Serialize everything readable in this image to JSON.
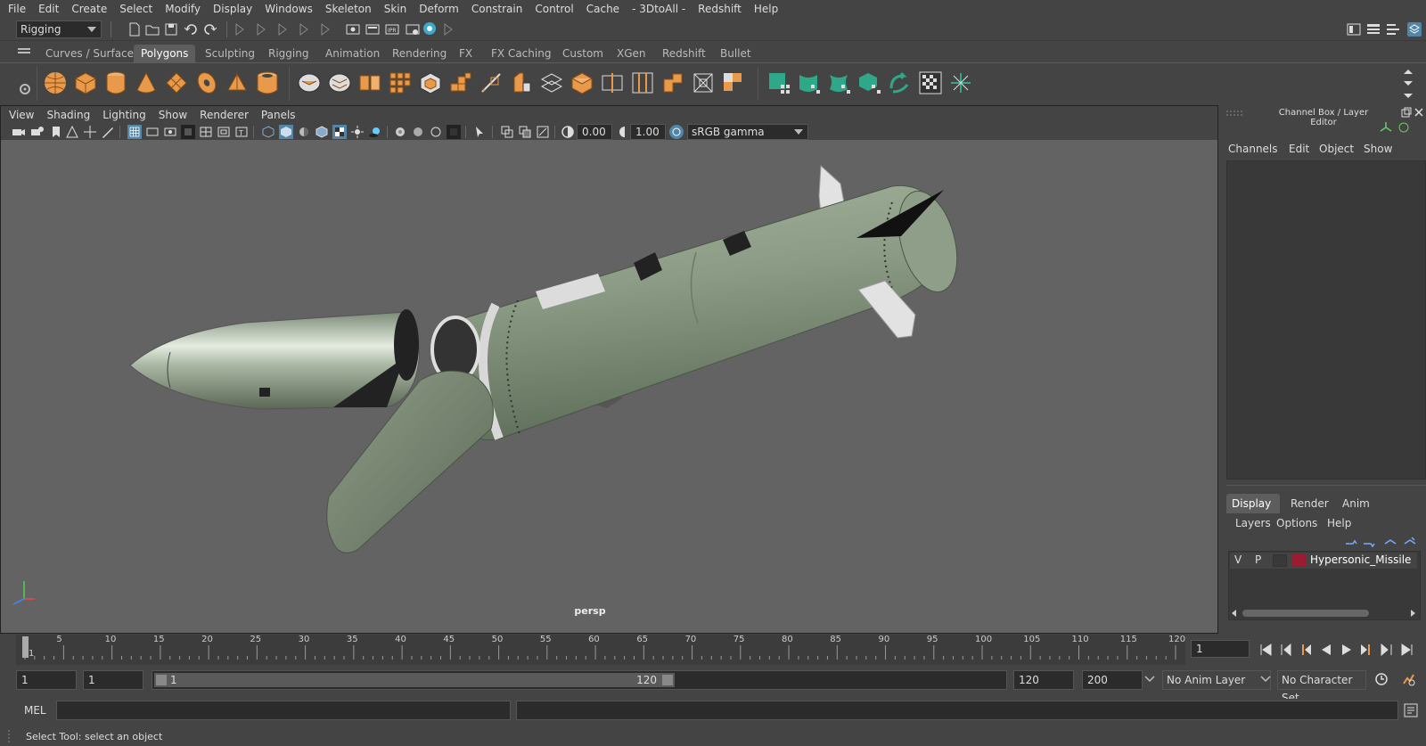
{
  "menubar": {
    "items": [
      "File",
      "Edit",
      "Create",
      "Select",
      "Modify",
      "Display",
      "Windows",
      "Skeleton",
      "Skin",
      "Deform",
      "Constrain",
      "Control",
      "Cache",
      "- 3DtoAll -",
      "Redshift",
      "Help"
    ]
  },
  "statusline": {
    "menuset": "Rigging"
  },
  "shelf": {
    "tabs": [
      "Curves / Surfaces",
      "Polygons",
      "Sculpting",
      "Rigging",
      "Animation",
      "Rendering",
      "FX",
      "FX Caching",
      "Custom",
      "XGen",
      "Redshift",
      "Bullet"
    ],
    "active_tab": "Polygons"
  },
  "viewport": {
    "menu": [
      "View",
      "Shading",
      "Lighting",
      "Show",
      "Renderer",
      "Panels"
    ],
    "exposure": "0.00",
    "gamma": "1.00",
    "color_space": "sRGB gamma",
    "camera_label": "persp"
  },
  "rightpanel": {
    "title": "Channel Box / Layer Editor",
    "channel_menu": [
      "Channels",
      "Edit",
      "Object",
      "Show"
    ],
    "layer_tabs": [
      "Display",
      "Render",
      "Anim"
    ],
    "active_layer_tab": "Display",
    "layer_menu": [
      "Layers",
      "Options",
      "Help"
    ],
    "layer": {
      "v": "V",
      "p": "P",
      "name": "Hypersonic_Missile",
      "color": "#9b1b30"
    }
  },
  "timeline": {
    "ticks": [
      "1",
      "5",
      "10",
      "15",
      "20",
      "25",
      "30",
      "35",
      "40",
      "45",
      "50",
      "55",
      "60",
      "65",
      "70",
      "75",
      "80",
      "85",
      "90",
      "95",
      "100",
      "105",
      "110",
      "115",
      "120"
    ],
    "current_frame": "1"
  },
  "rangebar": {
    "start": "1",
    "range_start": "1",
    "slider_start": "1",
    "slider_end": "120",
    "range_end": "120",
    "end": "200",
    "anim_layer": "No Anim Layer",
    "character_set": "No Character Set"
  },
  "cmdline": {
    "label": "MEL"
  },
  "helpline": {
    "text": "Select Tool: select an object"
  },
  "colors": {
    "ui_bg": "#444444",
    "viewport_bg": "#636363",
    "missile_body": "#8a9a84",
    "fin": "#e2e2e2",
    "accent_blue": "#5285a6"
  }
}
